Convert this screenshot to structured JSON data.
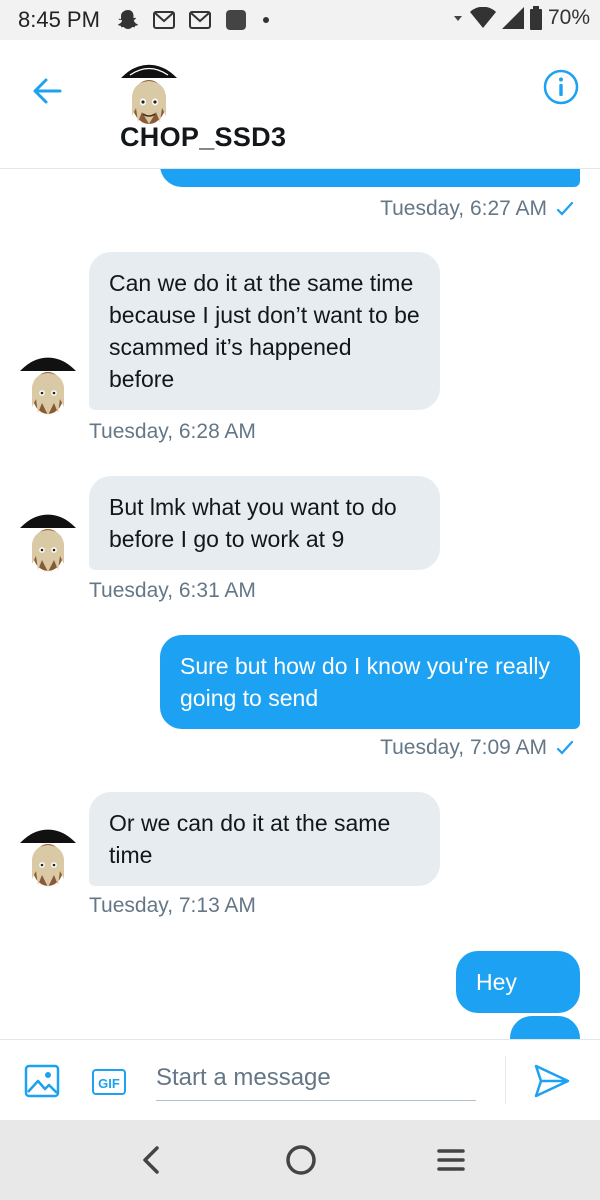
{
  "status_bar": {
    "time": "8:45 PM",
    "battery": "70%",
    "icons": [
      "snapchat-icon",
      "gmail-icon",
      "gmail-icon",
      "app-icon",
      "dot-icon",
      "wifi-icon",
      "signal-icon",
      "battery-icon"
    ]
  },
  "header": {
    "contact_name": "CHOP_SSD3",
    "back_icon": "arrow-left-icon",
    "info_icon": "info-icon"
  },
  "colors": {
    "accent": "#1da1f2",
    "incoming_bubble": "#e6ecf0",
    "timestamp": "#657786"
  },
  "messages": [
    {
      "direction": "outgoing",
      "text": "",
      "timestamp": "Tuesday, 6:27 AM"
    },
    {
      "direction": "incoming",
      "text": "Can we do it at the same time because I just don’t want to be scammed it’s happened before",
      "timestamp": "Tuesday, 6:28 AM"
    },
    {
      "direction": "incoming",
      "text": "But lmk what you want to do before I go to work at 9",
      "timestamp": "Tuesday, 6:31 AM"
    },
    {
      "direction": "outgoing",
      "text": "Sure but how do I know you're really going to send",
      "timestamp": "Tuesday, 7:09 AM"
    },
    {
      "direction": "incoming",
      "text": "Or we can do it at the same time",
      "timestamp": "Tuesday, 7:13 AM"
    },
    {
      "direction": "outgoing",
      "text": "Hey",
      "timestamp": ""
    }
  ],
  "composer": {
    "placeholder": "Start a message",
    "value": "",
    "gif_label": "GIF"
  }
}
